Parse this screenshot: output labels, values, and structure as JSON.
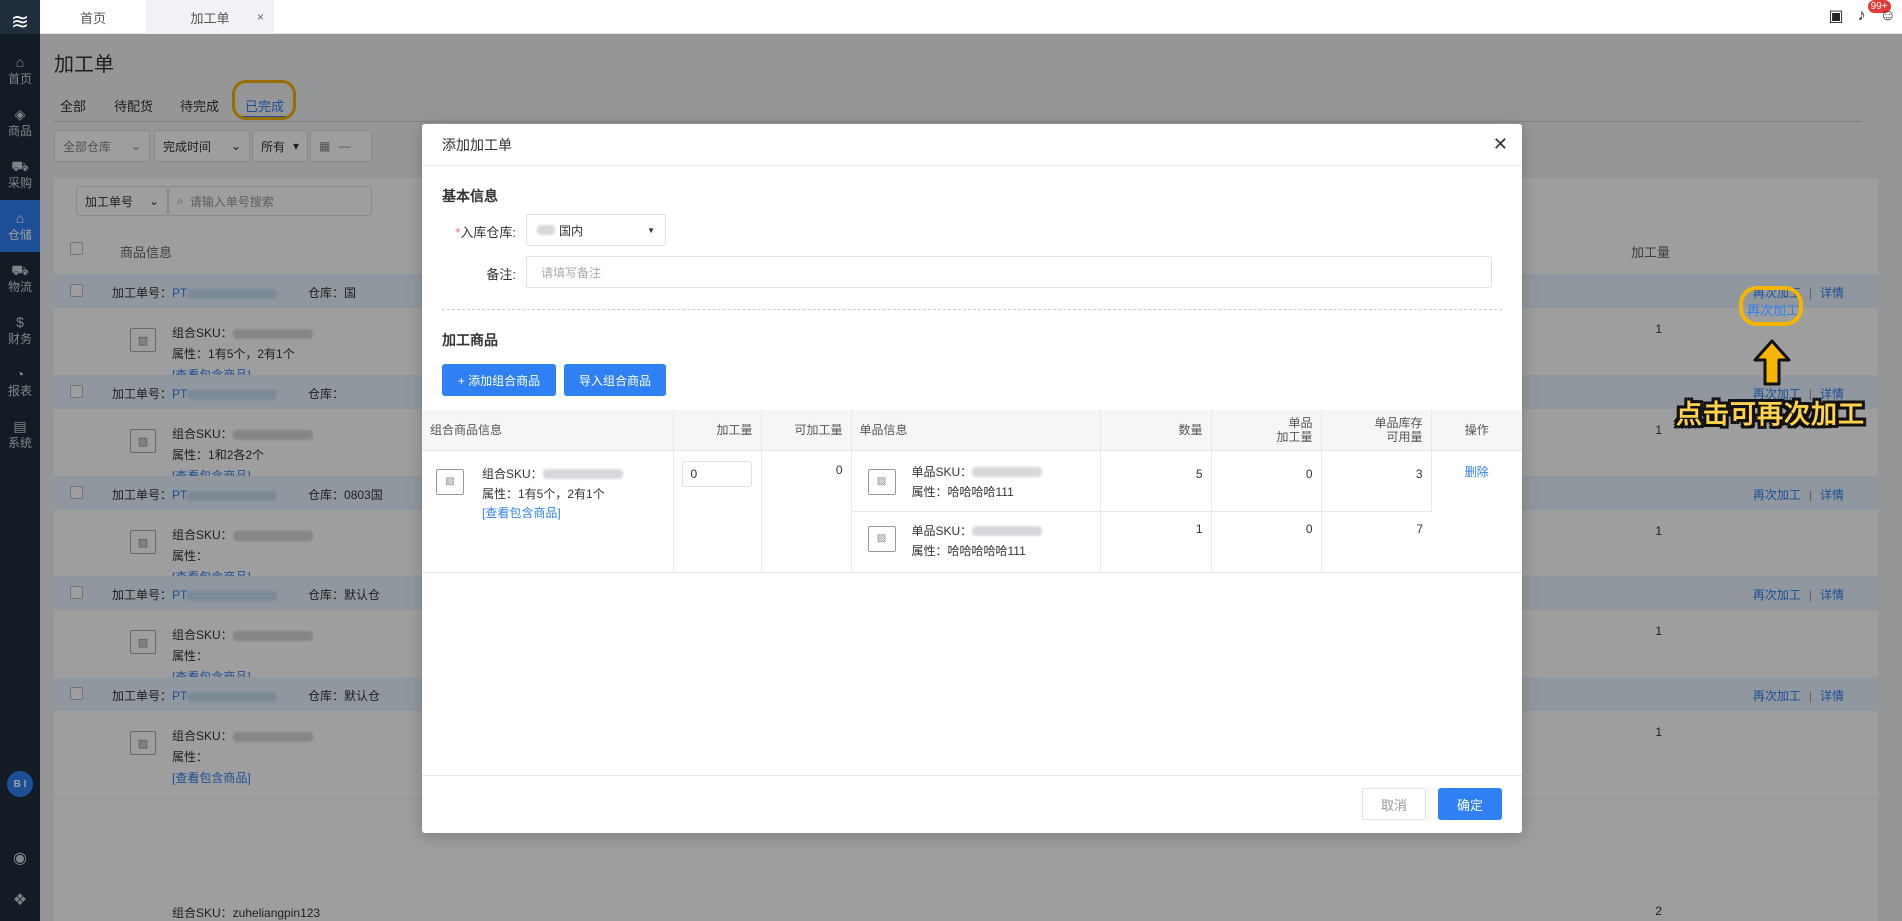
{
  "sidebar": {
    "logo": "≋",
    "items": [
      {
        "icon": "home-icon",
        "glyph": "⌂",
        "label": "首页"
      },
      {
        "icon": "goods-icon",
        "glyph": "◈",
        "label": "商品"
      },
      {
        "icon": "cart-icon",
        "glyph": "⛟",
        "label": "采购"
      },
      {
        "icon": "warehouse-icon",
        "glyph": "⌂",
        "label": "仓储"
      },
      {
        "icon": "truck-icon",
        "glyph": "⛟",
        "label": "物流"
      },
      {
        "icon": "money-icon",
        "glyph": "$",
        "label": "财务"
      },
      {
        "icon": "chart-icon",
        "glyph": "◔",
        "label": "报表"
      },
      {
        "icon": "system-icon",
        "glyph": "▤",
        "label": "系统"
      }
    ],
    "active_index": 3,
    "bi_label": "B I"
  },
  "topbar": {
    "tabs": [
      {
        "label": "首页"
      },
      {
        "label": "加工单",
        "close": "×"
      }
    ],
    "badge": "99+"
  },
  "page": {
    "title": "加工单",
    "status_tabs": [
      "全部",
      "待配货",
      "待完成",
      "已完成"
    ],
    "filters": {
      "warehouse": "全部仓库",
      "time": "完成时间",
      "scope": "所有",
      "date_sep": "—"
    },
    "search": {
      "type": "加工单号",
      "placeholder": "请输入单号搜索"
    },
    "columns": {
      "goods": "商品信息",
      "qty": "加工量"
    },
    "order_label": "加工单号：",
    "order_prefix": "PT",
    "warehouse_label": "仓库：",
    "combo_sku_label": "组合SKU：",
    "attr_label": "属性：",
    "view_link": "[查看包含商品]",
    "reprocess": "再次加工",
    "detail": "详情",
    "orders": [
      {
        "warehouse": "国",
        "attr": "1有5个，2有1个",
        "qty": "1"
      },
      {
        "warehouse": "",
        "attr": "1和2各2个",
        "qty": "1"
      },
      {
        "warehouse": "0803国",
        "attr": "",
        "qty": "1"
      },
      {
        "warehouse": "默认仓",
        "attr": "",
        "qty": "1"
      },
      {
        "warehouse": "默认仓",
        "attr": "",
        "qty": "1"
      }
    ],
    "last_row_sku": "组合SKU：zuheliangpin123",
    "last_row_qty": "2"
  },
  "annotation": {
    "link": "再次加工",
    "text": "点击可再次加工"
  },
  "modal": {
    "title": "添加加工单",
    "close": "✕",
    "basic_info": "基本信息",
    "warehouse_label": "入库仓库:",
    "warehouse_value": "国内",
    "note_label": "备注:",
    "note_placeholder": "请填写备注",
    "goods_title": "加工商品",
    "add_btn": "+ 添加组合商品",
    "import_btn": "导入组合商品",
    "table_headers": {
      "combo": "组合商品信息",
      "process_qty": "加工量",
      "available": "可加工量",
      "single": "单品信息",
      "count": "数量",
      "single_qty_1": "单品",
      "single_qty_2": "加工量",
      "stock_1": "单品库存",
      "stock_2": "可用量",
      "ops": "操作"
    },
    "row": {
      "combo_sku_label": "组合SKU：",
      "combo_attr": "属性：1有5个，2有1个",
      "view_link": "[查看包含商品]",
      "input_value": "0",
      "available": "0",
      "delete": "删除",
      "singles": [
        {
          "sku_label": "单品SKU：",
          "attr": "属性：哈哈哈哈111",
          "count": "5",
          "process": "0",
          "stock": "3"
        },
        {
          "sku_label": "单品SKU：",
          "attr": "属性：哈哈哈哈哈111",
          "count": "1",
          "process": "0",
          "stock": "7"
        }
      ]
    },
    "cancel": "取消",
    "confirm": "确定"
  }
}
